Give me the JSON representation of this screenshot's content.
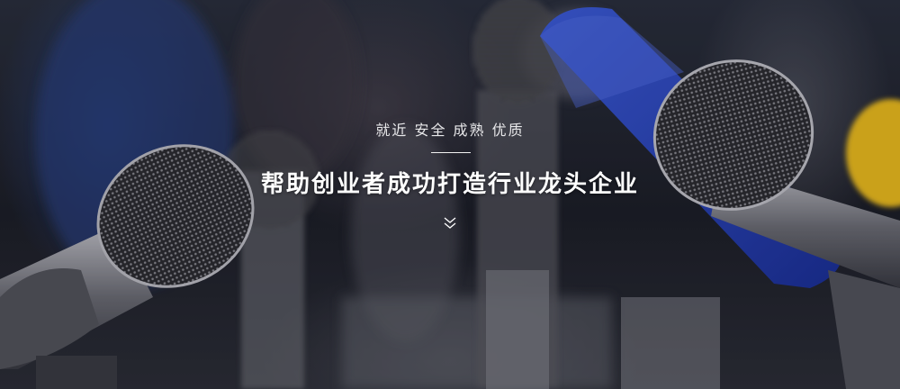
{
  "banner": {
    "tagline": "就近 安全 成熟 优质",
    "headline": "帮助创业者成功打造行业龙头企业",
    "scroll_icon": "double-chevron-down-icon",
    "colors": {
      "text": "#ffffff",
      "foam_blue": "#2a49c8",
      "accent_yellow": "#f4c21c"
    }
  }
}
